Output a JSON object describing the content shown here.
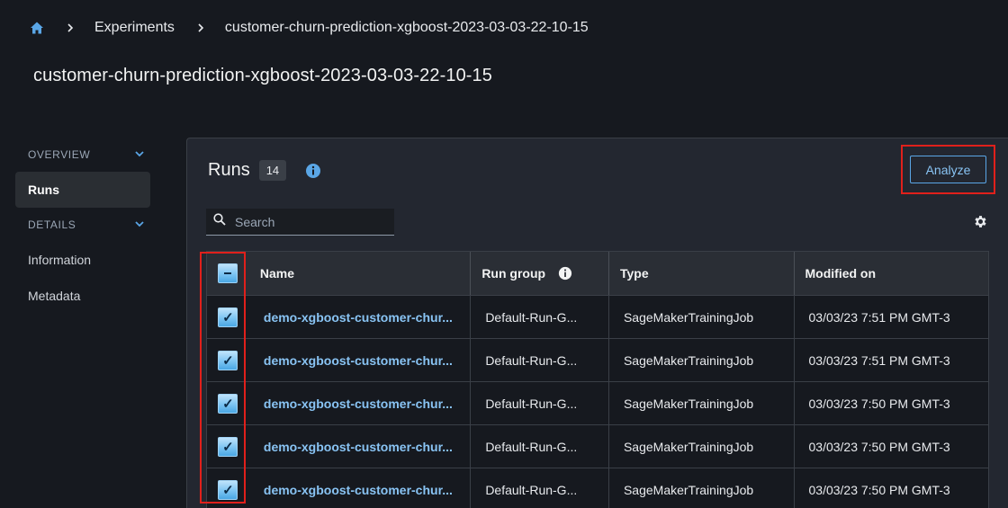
{
  "breadcrumb": {
    "items": [
      "Experiments",
      "customer-churn-prediction-xgboost-2023-03-03-22-10-15"
    ]
  },
  "page_title": "customer-churn-prediction-xgboost-2023-03-03-22-10-15",
  "sidebar": {
    "overview_label": "OVERVIEW",
    "runs_label": "Runs",
    "details_label": "DETAILS",
    "information_label": "Information",
    "metadata_label": "Metadata"
  },
  "runs": {
    "title": "Runs",
    "count": "14",
    "analyze_label": "Analyze",
    "search_placeholder": "Search"
  },
  "table": {
    "headers": [
      "Name",
      "Run group",
      "Type",
      "Modified on"
    ],
    "rows": [
      {
        "name": "demo-xgboost-customer-chur...",
        "group": "Default-Run-G...",
        "type": "SageMakerTrainingJob",
        "modified": "03/03/23 7:51 PM GMT-3"
      },
      {
        "name": "demo-xgboost-customer-chur...",
        "group": "Default-Run-G...",
        "type": "SageMakerTrainingJob",
        "modified": "03/03/23 7:51 PM GMT-3"
      },
      {
        "name": "demo-xgboost-customer-chur...",
        "group": "Default-Run-G...",
        "type": "SageMakerTrainingJob",
        "modified": "03/03/23 7:50 PM GMT-3"
      },
      {
        "name": "demo-xgboost-customer-chur...",
        "group": "Default-Run-G...",
        "type": "SageMakerTrainingJob",
        "modified": "03/03/23 7:50 PM GMT-3"
      },
      {
        "name": "demo-xgboost-customer-chur...",
        "group": "Default-Run-G...",
        "type": "SageMakerTrainingJob",
        "modified": "03/03/23 7:50 PM GMT-3"
      }
    ]
  },
  "colors": {
    "background": "#16191f",
    "panel": "#232730",
    "link": "#89c4f4",
    "highlight": "#e0201b",
    "checkbox": "#7cc4f2"
  },
  "icons": {
    "home": "home-icon",
    "separator": "chevron-right-icon",
    "expand": "chevron-down-icon",
    "info": "info-icon",
    "search": "search-icon",
    "settings": "gear-icon",
    "check": "checkmark-icon"
  }
}
